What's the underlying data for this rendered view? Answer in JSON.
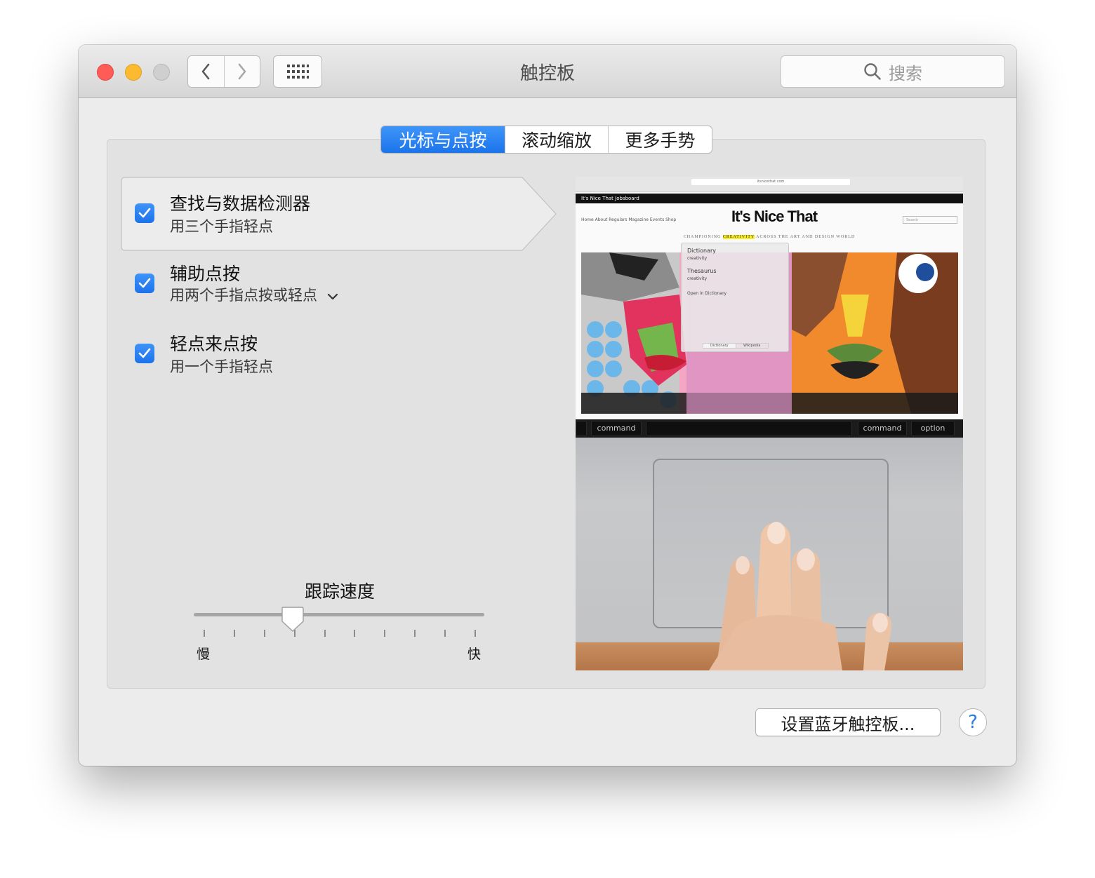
{
  "window": {
    "title": "触控板",
    "search_placeholder": "搜索",
    "back_icon": "chevron-left-icon",
    "forward_icon": "chevron-right-icon",
    "grid_icon": "grid-icon"
  },
  "tabs": [
    {
      "label": "光标与点按",
      "selected": true
    },
    {
      "label": "滚动缩放",
      "selected": false
    },
    {
      "label": "更多手势",
      "selected": false
    }
  ],
  "options": [
    {
      "title": "查找与数据检测器",
      "subtitle": "用三个手指轻点",
      "checked": true,
      "highlighted": true
    },
    {
      "title": "辅助点按",
      "subtitle": "用两个手指点按或轻点",
      "checked": true,
      "has_dropdown": true
    },
    {
      "title": "轻点来点按",
      "subtitle": "用一个手指轻点",
      "checked": true
    }
  ],
  "tracking_speed": {
    "title": "跟踪速度",
    "min_label": "慢",
    "max_label": "快",
    "tick_count": 10,
    "value_fraction": 0.33
  },
  "preview": {
    "url": "itsnicethat.com",
    "topbar": "It's Nice That   Jobsboard",
    "nav": "Home   About   Regulars   Magazine   Events   Shop",
    "logo": "It's Nice That",
    "search": "Search",
    "tagline_before": "CHAMPIONING ",
    "tagline_highlight": "CREATIVITY",
    "tagline_after": " ACROSS THE ART AND DESIGN WORLD",
    "popup": {
      "dictionary": "Dictionary",
      "thesaurus": "Thesaurus",
      "word": "creativity",
      "open_link": "Open in Dictionary",
      "tab1": "Dictionary",
      "tab2": "Wikipedia"
    },
    "keys": [
      "command",
      "command",
      "option"
    ]
  },
  "buttons": {
    "bluetooth": "设置蓝牙触控板...",
    "help": "?"
  },
  "colors": {
    "accent": "#1c74ec",
    "close": "#fd5d56",
    "minimize": "#fcbb2f",
    "zoom": "#cfcfcf"
  }
}
